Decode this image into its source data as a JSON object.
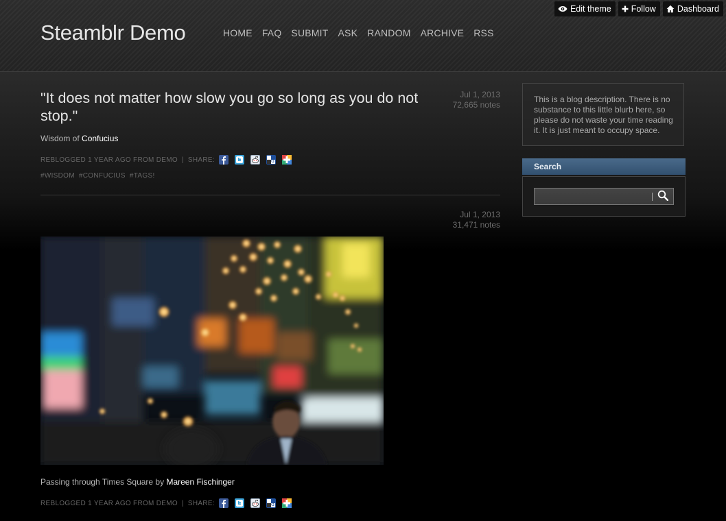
{
  "site": {
    "title": "Steamblr Demo",
    "nav": [
      "HOME",
      "FAQ",
      "SUBMIT",
      "ASK",
      "RANDOM",
      "ARCHIVE",
      "RSS"
    ]
  },
  "controls": {
    "edit_theme": "Edit theme",
    "follow": "Follow",
    "dashboard": "Dashboard"
  },
  "posts": [
    {
      "type": "quote",
      "quote": "\"It does not matter how slow you go so long as you do not stop.\"",
      "date": "Jul 1, 2013",
      "notes": "72,665 notes",
      "source_prefix": "Wisdom of",
      "source_name": "Confucius",
      "reblog": "REBLOGGED 1 YEAR AGO FROM DEMO",
      "sep": "|",
      "share": "SHARE:",
      "tags": [
        "#WISDOM",
        "#CONFUCIUS",
        "#TAGS!"
      ]
    },
    {
      "type": "photo",
      "date": "Jul 1, 2013",
      "notes": "31,471 notes",
      "caption_prefix": "Passing through Times Square by",
      "caption_author": "Mareen Fischinger",
      "reblog": "REBLOGGED 1 YEAR AGO FROM DEMO",
      "sep": "|",
      "share": "SHARE:"
    }
  ],
  "share_icons": [
    "facebook-icon",
    "twitter-icon",
    "reddit-icon",
    "delicious-icon",
    "google-plus-icon"
  ],
  "sidebar": {
    "description": "This is a blog description. There is no substance to this little blurb here, so please do not waste your time reading it. It is just meant to occupy space.",
    "search_title": "Search",
    "search_value": ""
  },
  "colors": {
    "header_bg": "#2a2a2a",
    "link_white": "#ffffff",
    "search_header": "#3d5d7e",
    "muted": "#6d6d6d"
  }
}
